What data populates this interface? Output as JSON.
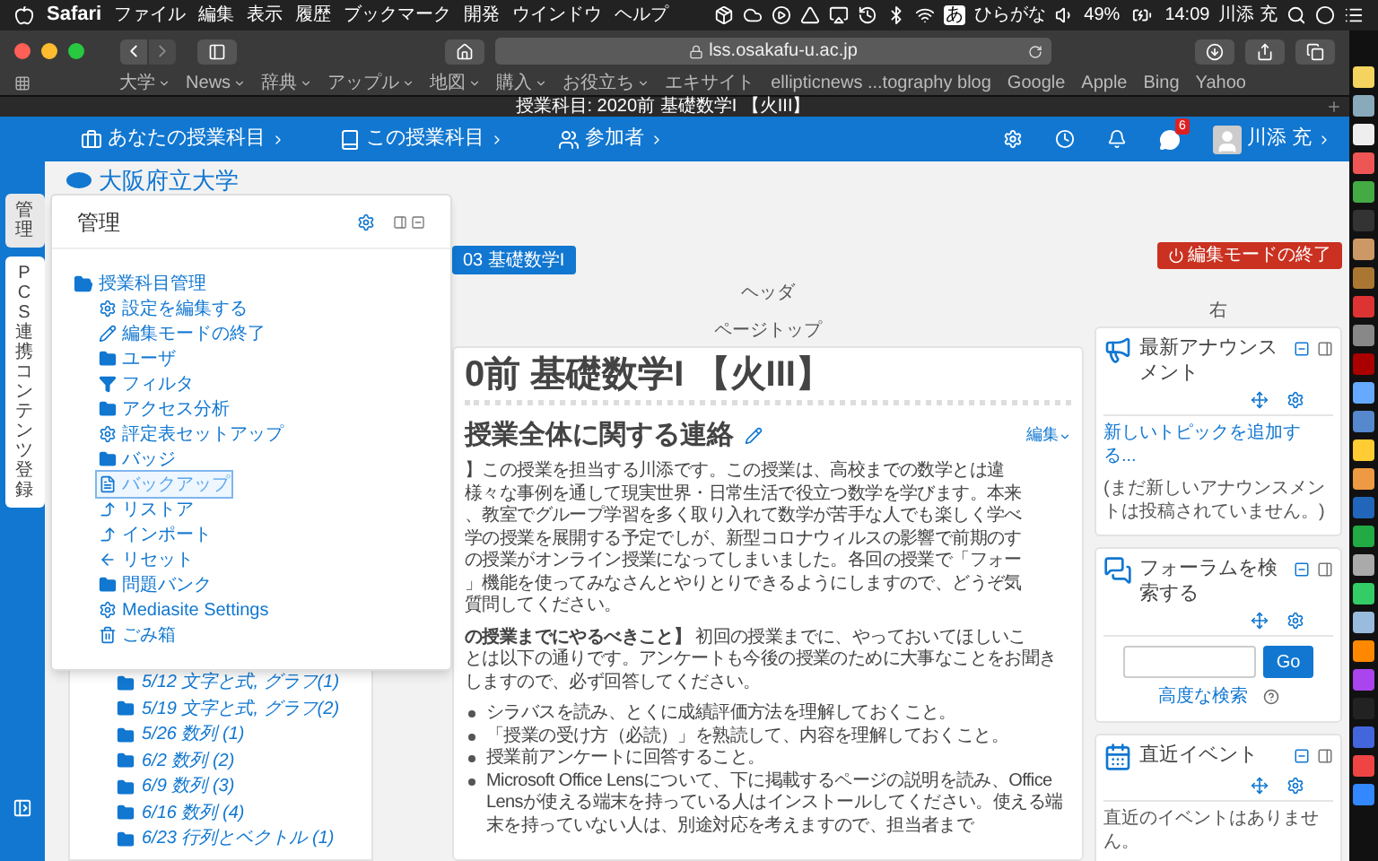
{
  "menubar": {
    "app": "Safari",
    "menus": [
      "ファイル",
      "編集",
      "表示",
      "履歴",
      "ブックマーク",
      "開発",
      "ウインドウ",
      "ヘルプ"
    ],
    "input_mode": "あ",
    "input_label": "ひらがな",
    "battery": "49%",
    "time": "14:09",
    "user": "川添 充"
  },
  "browser": {
    "url": "lss.osakafu-u.ac.jp",
    "bookmarks": [
      {
        "label": "大学",
        "kind": "menu"
      },
      {
        "label": "News",
        "kind": "menu"
      },
      {
        "label": "辞典",
        "kind": "menu"
      },
      {
        "label": "アップル",
        "kind": "menu"
      },
      {
        "label": "地図",
        "kind": "menu"
      },
      {
        "label": "購入",
        "kind": "menu"
      },
      {
        "label": "お役立ち",
        "kind": "menu"
      },
      {
        "label": "エキサイト",
        "kind": "link"
      },
      {
        "label": "ellipticnews ...tography blog",
        "kind": "link"
      },
      {
        "label": "Google",
        "kind": "link"
      },
      {
        "label": "Apple",
        "kind": "link"
      },
      {
        "label": "Bing",
        "kind": "link"
      },
      {
        "label": "Yahoo",
        "kind": "link"
      }
    ],
    "tab_title": "授業科目: 2020前 基礎数学I 【火III】"
  },
  "navbar": {
    "items": [
      {
        "label": "あなたの授業科目",
        "kind": "courses"
      },
      {
        "label": "この授業科目",
        "kind": "course"
      },
      {
        "label": "参加者",
        "kind": "participants"
      }
    ],
    "message_count": "6",
    "user": "川添 充"
  },
  "drawer_tabs": [
    {
      "label": "管理",
      "selected": true
    },
    {
      "label": "PCS連携コンテンツ登録",
      "selected": false
    }
  ],
  "site_name": "大阪府立大学",
  "admin_panel": {
    "title": "管理",
    "root": {
      "label": "授業科目管理",
      "expanded": true,
      "children": [
        {
          "label": "設定を編集する",
          "kind": "settings",
          "selected": false
        },
        {
          "label": "編集モードの終了",
          "kind": "edit",
          "selected": false
        },
        {
          "label": "ユーザ",
          "kind": "folder",
          "selected": false
        },
        {
          "label": "フィルタ",
          "kind": "filter",
          "selected": false
        },
        {
          "label": "アクセス分析",
          "kind": "folder",
          "selected": false
        },
        {
          "label": "評定表セットアップ",
          "kind": "settings",
          "selected": false
        },
        {
          "label": "バッジ",
          "kind": "folder",
          "selected": false
        },
        {
          "label": "バックアップ",
          "kind": "file",
          "selected": true
        },
        {
          "label": "リストア",
          "kind": "up",
          "selected": false
        },
        {
          "label": "インポート",
          "kind": "up",
          "selected": false
        },
        {
          "label": "リセット",
          "kind": "back",
          "selected": false
        },
        {
          "label": "問題バンク",
          "kind": "folder",
          "selected": false
        },
        {
          "label": "Mediasite Settings",
          "kind": "settings",
          "selected": false
        },
        {
          "label": "ごみ箱",
          "kind": "trash",
          "selected": false
        }
      ]
    }
  },
  "course_sections": [
    "5/12 文字と式, グラフ(1)",
    "5/19 文字と式, グラフ(2)",
    "5/26 数列 (1)",
    "6/2 数列 (2)",
    "6/9 数列 (3)",
    "6/16 数列 (4)",
    "6/23 行列とベクトル (1)"
  ],
  "breadcrumb_button": "03 基礎数学I",
  "edit_mode_button": "編集モードの終了",
  "region_labels": {
    "header": "ヘッダ",
    "page_top": "ページトップ",
    "right": "右"
  },
  "course": {
    "title": "0前 基礎数学I 【火III】",
    "section_title": "授業全体に関する連絡",
    "edit_menu": "編集",
    "paragraphs": [
      {
        "lines": [
          "】この授業を担当する川添です。この授業は、高校までの数学とは違",
          "様々な事例を通して現実世界・日常生活で役立つ数学を学びます。本来",
          "、教室でグループ学習を多く取り入れて数学が苦手な人でも楽しく学べ",
          "学の授業を展開する予定でしが、新型コロナウィルスの影響で前期のす",
          "の授業がオンライン授業になってしまいました。各回の授業で「フォー",
          "」機能を使ってみなさんとやりとりできるようにしますので、どうぞ気",
          "質問してください。"
        ]
      },
      {
        "lines": [
          "**の授業までにやるべきこと】** 初回の授業までに、やっておいてほしいこ",
          "とは以下の通りです。アンケートも今後の授業のために大事なことをお聞き",
          "しますので、必ず回答してください。"
        ]
      }
    ],
    "bullets": [
      "シラバスを読み、とくに成績評価方法を理解しておくこと。",
      "「授業の受け方（必読）」を熟読して、内容を理解しておくこと。",
      "授業前アンケートに回答すること。",
      "Microsoft Office Lensについて、下に掲載するページの説明を読み、Office Lensが使える端末を持っている人はインストールしてください。使える端末を持っていない人は、別途対応を考えますので、担当者まで"
    ]
  },
  "blocks": [
    {
      "kind": "announcements",
      "title": "最新アナウンスメント",
      "link": "新しいトピックを追加する...",
      "text": "(まだ新しいアナウンスメントは投稿されていません。)"
    },
    {
      "kind": "search",
      "title": "フォーラムを検索する",
      "button": "Go",
      "link": "高度な検索"
    },
    {
      "kind": "events",
      "title": "直近イベント",
      "text": "直近のイベントはありません。"
    }
  ]
}
